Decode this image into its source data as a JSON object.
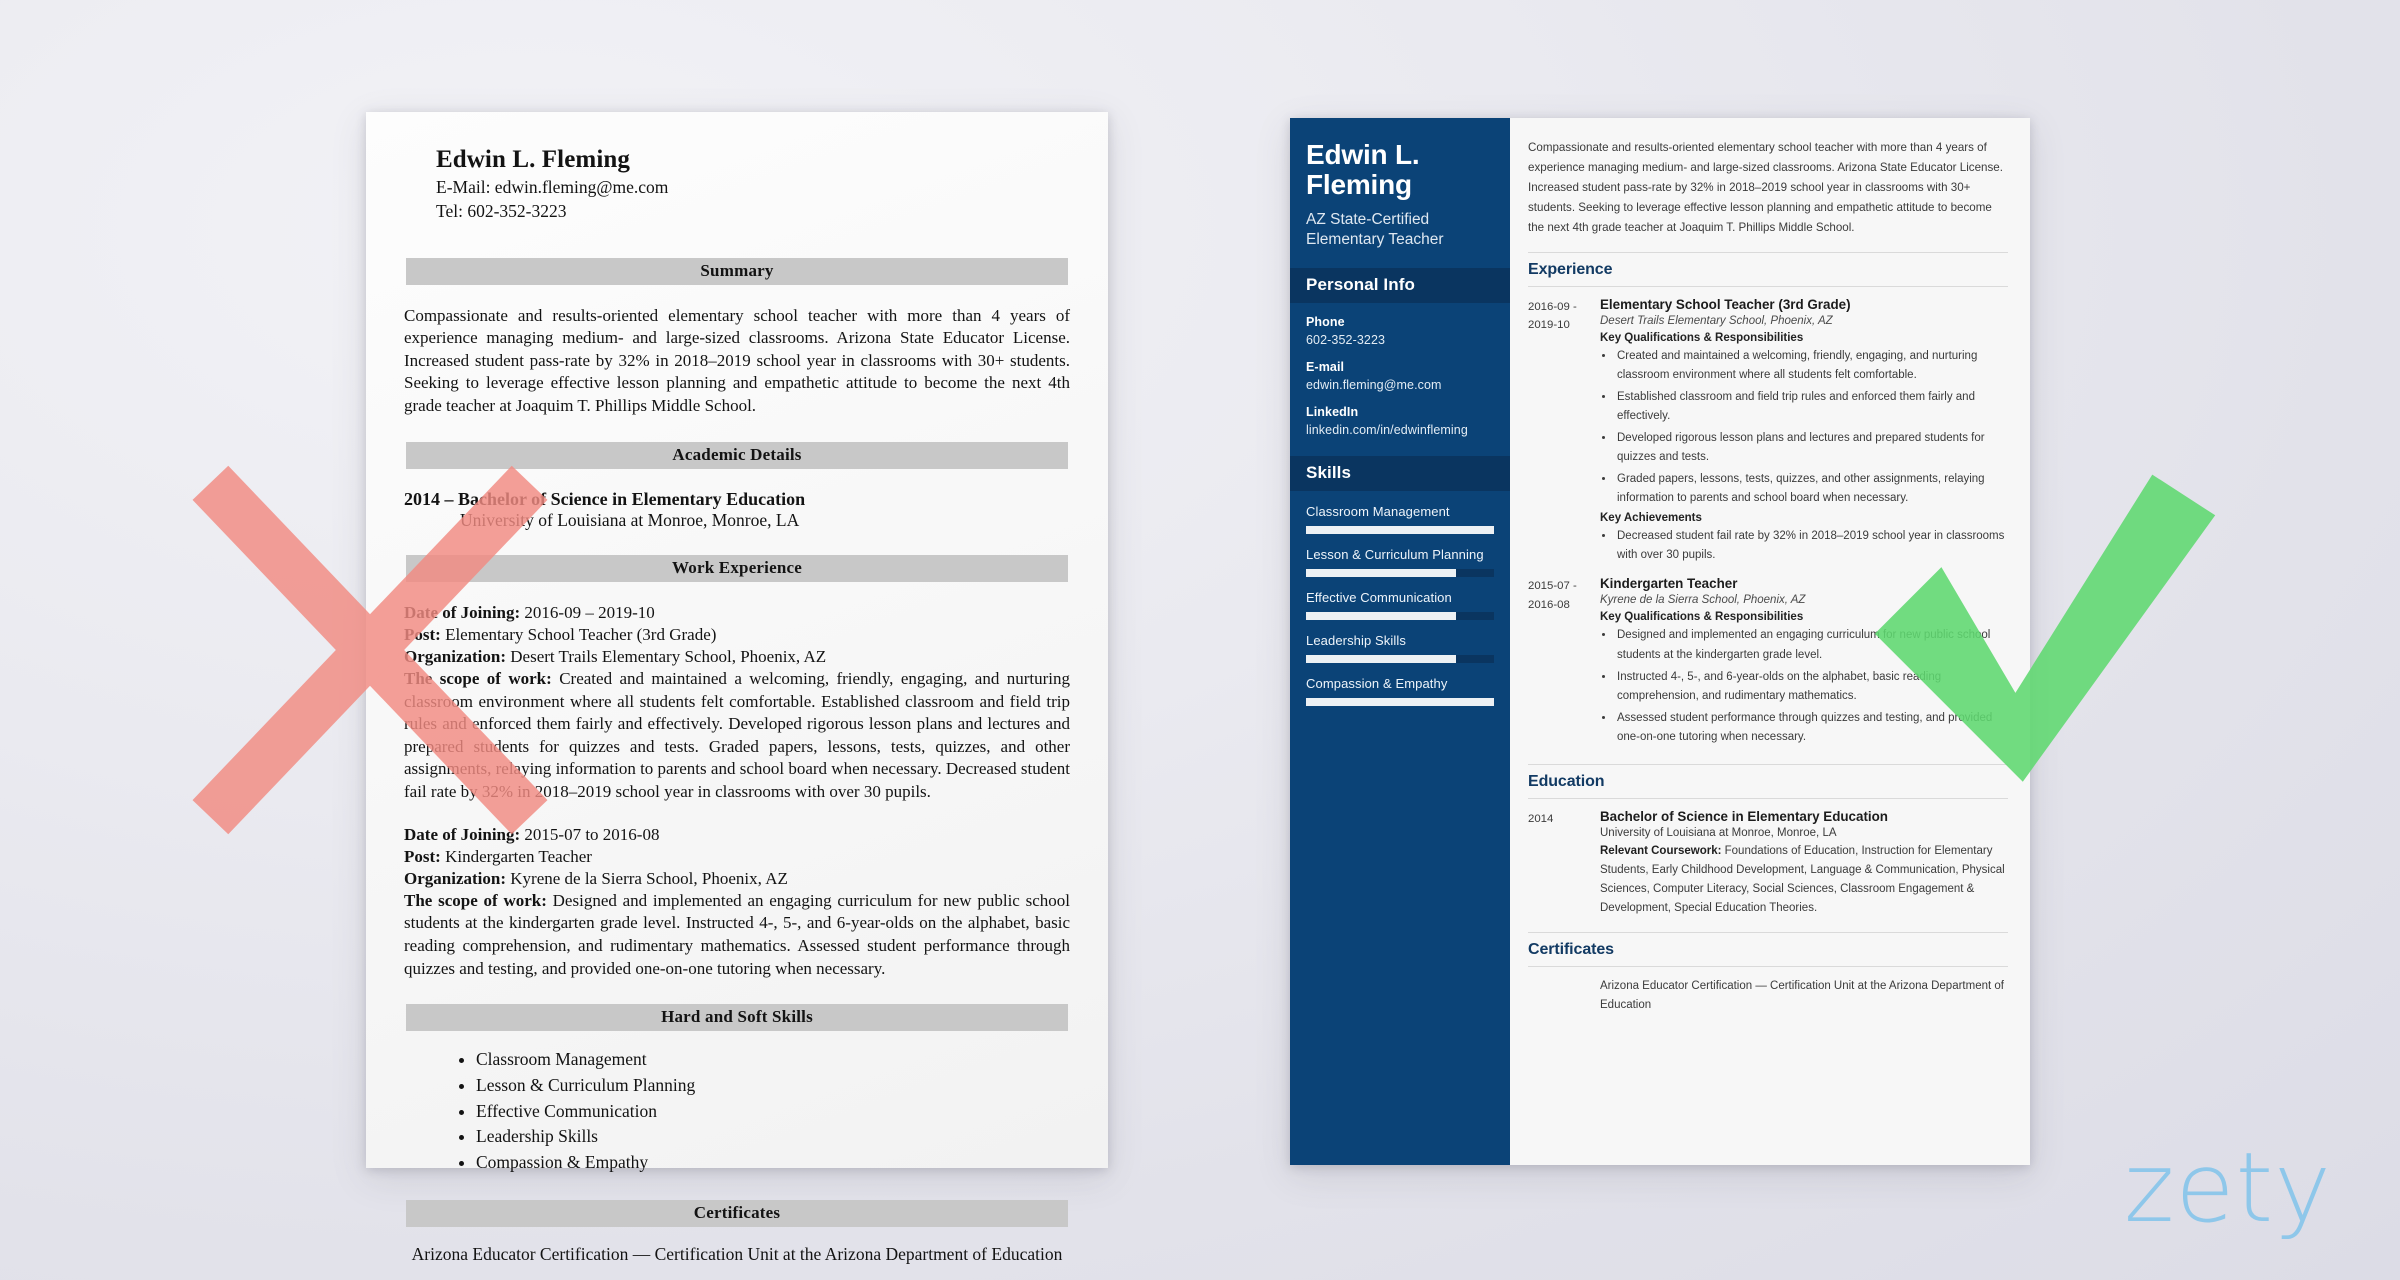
{
  "colors": {
    "sidebar_blue": "#0b4377",
    "sidebar_head_blue": "#0a3560",
    "section_heading_blue": "#123a63",
    "mark_x_red": "#f28b82",
    "mark_check_green": "#5ed870",
    "logo_blue": "#8ec7ea",
    "page_background": "#e7e7ee"
  },
  "watermark": {
    "text": "zety"
  },
  "marks": {
    "reject": "red-x-mark",
    "approve": "green-check-mark"
  },
  "bad_resume": {
    "name": "Edwin L. Fleming",
    "email": "E-Mail: edwin.fleming@me.com",
    "phone": "Tel: 602-352-3223",
    "sections": {
      "summary_heading": "Summary",
      "summary_text": "Compassionate and results-oriented elementary school teacher with more than 4 years of experience managing medium- and large-sized classrooms. Arizona State Educator License. Increased student pass-rate by 32% in 2018–2019 school year in classrooms with 30+ students. Seeking to leverage effective lesson planning and empathetic attitude to become the next 4th grade teacher at Joaquim T. Phillips Middle School.",
      "academic_heading": "Academic Details",
      "academic_degree": "2014 – Bachelor of Science in Elementary Education",
      "academic_school": "University of Louisiana at Monroe, Monroe, LA",
      "work_heading": "Work Experience",
      "skills_heading": "Hard and Soft Skills",
      "certificates_heading": "Certificates",
      "certificate_text": "Arizona Educator Certification — Certification Unit at the Arizona Department of Education"
    },
    "labels": {
      "date": "Date of Joining:",
      "post": "Post:",
      "org": "Organization:",
      "scope": "The scope of work:"
    },
    "jobs": [
      {
        "date": "2016-09 – 2019-10",
        "post": "Elementary School Teacher (3rd Grade)",
        "org": "Desert Trails Elementary School, Phoenix, AZ",
        "scope": "Created and maintained a welcoming, friendly, engaging, and nurturing classroom environment where all students felt comfortable. Established classroom and field trip rules and enforced them fairly and effectively. Developed rigorous lesson plans and lectures and prepared students for quizzes and tests. Graded papers, lessons, tests, quizzes, and other assignments, relaying information to parents and school board when necessary. Decreased student fail rate by 32% in 2018–2019 school year in classrooms with over 30 pupils."
      },
      {
        "date": "2015-07 to 2016-08",
        "post": "Kindergarten Teacher",
        "org": "Kyrene de la Sierra School, Phoenix, AZ",
        "scope": "Designed and implemented an engaging curriculum for new public school students at the kindergarten grade level. Instructed 4-, 5-, and 6-year-olds on the alphabet, basic reading comprehension, and rudimentary mathematics. Assessed student performance through quizzes and testing, and provided one-on-one tutoring when necessary."
      }
    ],
    "skills": [
      "Classroom Management",
      "Lesson & Curriculum Planning",
      "Effective Communication",
      "Leadership Skills",
      "Compassion & Empathy"
    ]
  },
  "good_resume": {
    "sidebar": {
      "name": "Edwin L. Fleming",
      "title": "AZ State-Certified Elementary Teacher",
      "personal_info_heading": "Personal Info",
      "contacts": [
        {
          "label": "Phone",
          "value": "602-352-3223"
        },
        {
          "label": "E-mail",
          "value": "edwin.fleming@me.com"
        },
        {
          "label": "LinkedIn",
          "value": "linkedin.com/in/edwinfleming"
        }
      ],
      "skills_heading": "Skills",
      "skills": [
        {
          "name": "Classroom Management",
          "level": 100
        },
        {
          "name": "Lesson & Curriculum Planning",
          "level": 80
        },
        {
          "name": "Effective Communication",
          "level": 80
        },
        {
          "name": "Leadership Skills",
          "level": 80
        },
        {
          "name": "Compassion & Empathy",
          "level": 100
        }
      ]
    },
    "main": {
      "summary": "Compassionate and results-oriented elementary school teacher with more than 4 years of experience managing medium- and large-sized classrooms. Arizona State Educator License. Increased student pass-rate by 32% in 2018–2019 school year in classrooms with 30+ students. Seeking to leverage effective lesson planning and empathetic attitude to become the next 4th grade teacher at Joaquim T. Phillips Middle School.",
      "experience_heading": "Experience",
      "education_heading": "Education",
      "certificates_heading": "Certificates",
      "qualifications_label": "Key Qualifications & Responsibilities",
      "achievements_label": "Key Achievements",
      "coursework_label": "Relevant Coursework:",
      "jobs": [
        {
          "date_from": "2016-09 -",
          "date_to": "2019-10",
          "title": "Elementary School Teacher (3rd Grade)",
          "org": "Desert Trails Elementary School, Phoenix, AZ",
          "responsibilities": [
            "Created and maintained a welcoming, friendly, engaging, and nurturing classroom environment where all students felt comfortable.",
            "Established classroom and field trip rules and enforced them fairly and effectively.",
            "Developed rigorous lesson plans and lectures and prepared students for quizzes and tests.",
            "Graded papers, lessons, tests, quizzes, and other assignments, relaying information to parents and school board when necessary."
          ],
          "achievements": [
            "Decreased student fail rate by 32% in 2018–2019 school year in classrooms with over 30 pupils."
          ]
        },
        {
          "date_from": "2015-07 -",
          "date_to": "2016-08",
          "title": "Kindergarten Teacher",
          "org": "Kyrene de la Sierra School, Phoenix, AZ",
          "responsibilities": [
            "Designed and implemented an engaging curriculum for new public school students at the kindergarten grade level.",
            "Instructed 4-, 5-, and 6-year-olds on the alphabet, basic reading comprehension, and rudimentary mathematics.",
            "Assessed student performance through quizzes and testing, and provided one-on-one tutoring when necessary."
          ],
          "achievements": []
        }
      ],
      "education": {
        "date": "2014",
        "degree": "Bachelor of Science in Elementary Education",
        "school": "University of Louisiana at Monroe, Monroe, LA",
        "coursework": "Foundations of Education, Instruction for Elementary Students, Early Childhood Development, Language & Communication, Physical Sciences, Computer Literacy, Social Sciences, Classroom Engagement & Development, Special Education Theories."
      },
      "certificate": "Arizona Educator Certification — Certification Unit at the Arizona Department of Education"
    }
  }
}
